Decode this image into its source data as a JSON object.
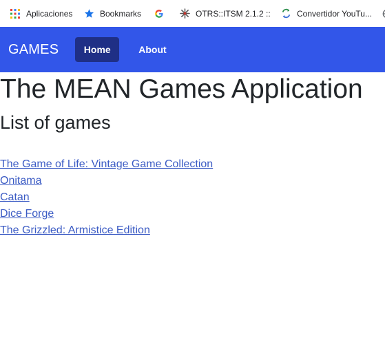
{
  "bookmarks": [
    {
      "label": "Aplicaciones",
      "icon": "apps-grid-icon"
    },
    {
      "label": "Bookmarks",
      "icon": "star-icon"
    },
    {
      "label": "",
      "icon": "google-icon"
    },
    {
      "label": "OTRS::ITSM 2.1.2 :: I...",
      "icon": "otrs-icon"
    },
    {
      "label": "Convertidor YouTu...",
      "icon": "converter-icon"
    }
  ],
  "navbar": {
    "brand": "GAMES",
    "home": "Home",
    "about": "About"
  },
  "main": {
    "title": "The MEAN Games Application",
    "list_heading": "List of games",
    "games": [
      "The Game of Life: Vintage Game Collection",
      "Onitama",
      "Catan",
      "Dice Forge",
      "The Grizzled: Armistice Edition"
    ]
  },
  "colors": {
    "navbar": "#3256e9",
    "active_nav": "#1f2f86",
    "link": "#3b5bc4"
  }
}
